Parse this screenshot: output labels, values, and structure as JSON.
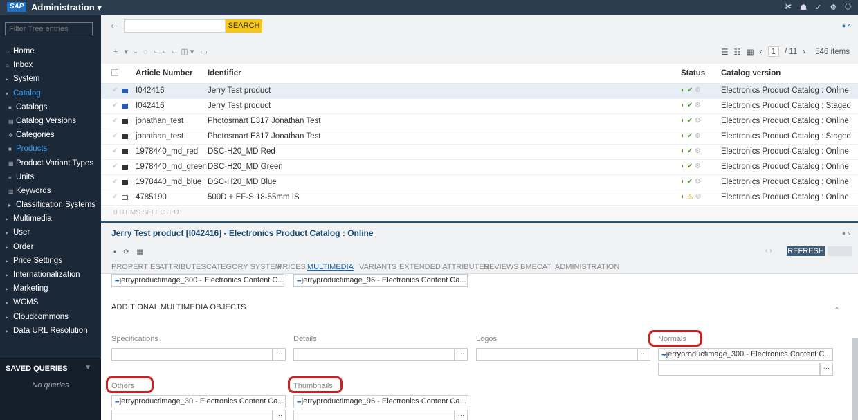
{
  "app": {
    "logo": "SAP",
    "title": "Administration ▾"
  },
  "topbar_icons": [
    "✀",
    "☗",
    "✓",
    "⚙",
    "⏻"
  ],
  "sidebar": {
    "filter_placeholder": "Filter Tree entries",
    "items": [
      {
        "label": "Home",
        "icon": "○",
        "level": 0
      },
      {
        "label": "Inbox",
        "icon": "⌂",
        "level": 0
      },
      {
        "label": "System",
        "icon": "▸",
        "level": 0
      },
      {
        "label": "Catalog",
        "icon": "▾",
        "level": 0,
        "active": true
      },
      {
        "label": "Catalogs",
        "icon": "■",
        "level": 1
      },
      {
        "label": "Catalog Versions",
        "icon": "▤",
        "level": 1
      },
      {
        "label": "Categories",
        "icon": "❖",
        "level": 1
      },
      {
        "label": "Products",
        "icon": "■",
        "level": 1,
        "active": true
      },
      {
        "label": "Product Variant Types",
        "icon": "▦",
        "level": 1
      },
      {
        "label": "Units",
        "icon": "≡",
        "level": 1
      },
      {
        "label": "Keywords",
        "icon": "▥",
        "level": 1
      },
      {
        "label": "Classification Systems",
        "icon": "▸",
        "level": 1
      },
      {
        "label": "Multimedia",
        "icon": "▸",
        "level": 0
      },
      {
        "label": "User",
        "icon": "▸",
        "level": 0
      },
      {
        "label": "Order",
        "icon": "▸",
        "level": 0
      },
      {
        "label": "Price Settings",
        "icon": "▸",
        "level": 0
      },
      {
        "label": "Internationalization",
        "icon": "▸",
        "level": 0
      },
      {
        "label": "Marketing",
        "icon": "▸",
        "level": 0
      },
      {
        "label": "WCMS",
        "icon": "▸",
        "level": 0
      },
      {
        "label": "Cloudcommons",
        "icon": "▸",
        "level": 0
      },
      {
        "label": "Data URL Resolution",
        "icon": "▸",
        "level": 0
      }
    ],
    "saved_queries": {
      "title": "SAVED QUERIES",
      "empty": "No queries"
    }
  },
  "search": {
    "value": "",
    "button": "SEARCH"
  },
  "pager": {
    "page": "1",
    "total": "/ 11",
    "items": "546 items"
  },
  "grid": {
    "columns": {
      "article": "Article Number",
      "identifier": "Identifier",
      "status": "Status",
      "catalog": "Catalog version"
    },
    "rows": [
      {
        "article": "I042416",
        "identifier": "Jerry Test product",
        "catalog": "Electronics Product Catalog : Online",
        "icon": "blue",
        "status": [
          "ok",
          "ok",
          "grey"
        ],
        "selected": true
      },
      {
        "article": "I042416",
        "identifier": "Jerry Test product",
        "catalog": "Electronics Product Catalog : Staged",
        "icon": "blue",
        "status": [
          "ok",
          "ok",
          "grey"
        ]
      },
      {
        "article": "jonathan_test",
        "identifier": "Photosmart E317 Jonathan Test",
        "catalog": "Electronics Product Catalog : Online",
        "icon": "dark",
        "status": [
          "ok",
          "ok",
          "grey"
        ]
      },
      {
        "article": "jonathan_test",
        "identifier": "Photosmart E317 Jonathan Test",
        "catalog": "Electronics Product Catalog : Staged",
        "icon": "dark",
        "status": [
          "ok",
          "ok",
          "grey"
        ]
      },
      {
        "article": "1978440_md_red",
        "identifier": "DSC-H20_MD Red",
        "catalog": "Electronics Product Catalog : Online",
        "icon": "dark",
        "status": [
          "ok",
          "ok",
          "grey"
        ]
      },
      {
        "article": "1978440_md_green",
        "identifier": "DSC-H20_MD Green",
        "catalog": "Electronics Product Catalog : Online",
        "icon": "dark",
        "status": [
          "ok",
          "ok",
          "grey"
        ]
      },
      {
        "article": "1978440_md_blue",
        "identifier": "DSC-H20_MD Blue",
        "catalog": "Electronics Product Catalog : Online",
        "icon": "dark",
        "status": [
          "ok",
          "ok",
          "grey"
        ]
      },
      {
        "article": "4785190",
        "identifier": "500D + EF-S 18-55mm IS",
        "catalog": "Electronics Product Catalog : Online",
        "icon": "box",
        "status": [
          "ok",
          "warn",
          "grey"
        ]
      }
    ],
    "selected_count": "0 ITEMS SELECTED"
  },
  "detail": {
    "title": "Jerry Test product [I042416] - Electronics Product Catalog : Online",
    "refresh": "REFRESH",
    "tabs": [
      "PROPERTIES",
      "ATTRIBUTES",
      "CATEGORY SYSTEM",
      "PRICES",
      "MULTIMEDIA",
      "VARIANTS",
      "EXTENDED ATTRIBUTES",
      "REVIEWS",
      "BMECAT",
      "ADMINISTRATION"
    ],
    "active_tab": "MULTIMEDIA",
    "top_refs": [
      "jerryproductimage_300 - Electronics Content C...",
      "jerryproductimage_96 - Electronics Content Ca..."
    ],
    "section": "ADDITIONAL MULTIMEDIA OBJECTS",
    "fields": {
      "specifications": "Specifications",
      "details": "Details",
      "logos": "Logos",
      "normals": "Normals",
      "normals_ref": "jerryproductimage_300 - Electronics Content C...",
      "others": "Others",
      "others_ref": "jerryproductimage_30 - Electronics Content Ca...",
      "thumbnails": "Thumbnails",
      "thumbnails_ref": "jerryproductimage_96 - Electronics Content Ca..."
    }
  },
  "colors": {
    "topbar": "#2b3d4f",
    "sidebar": "#1b2838",
    "active": "#3b9ff2",
    "search_btn": "#f5c518",
    "highlight": "#cc1f1f"
  }
}
